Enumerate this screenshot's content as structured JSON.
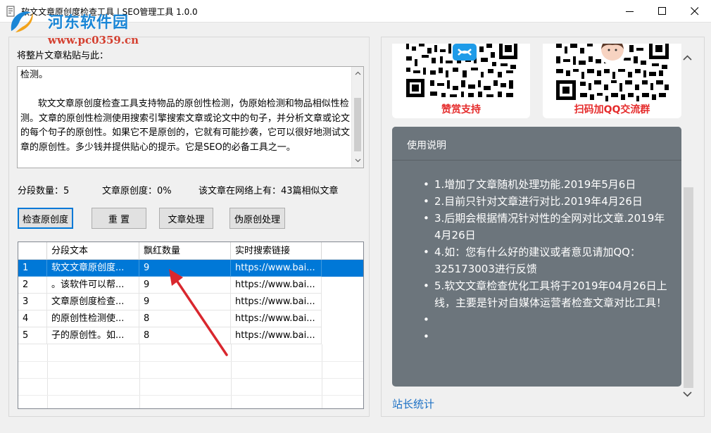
{
  "window": {
    "title": "软文文章原创度检查工具 | SEO管理工具 1.0.0"
  },
  "watermark": {
    "site_name": "河东软件园",
    "url": "www.pc0359.cn"
  },
  "editor": {
    "label": "将整片文章粘贴与此：",
    "text": "检测。\n\n      软文文章原创度检查工具支持物品的原创性检测，伪原始检测和物品相似性检测。文章的原创性检测使用搜索引擎搜索文章或论文中的句子，并分析文章或论文的每个句子的原创性。如果它不是原创的，它就有可能抄袭，它可以很好地测试文章的原创性。多少钱并提供贴心的提示。它是SEO的必备工具之一。"
  },
  "stats": {
    "segments": "分段数量：5",
    "originality": "文章原创度：0%",
    "similar": "该文章在网络上有：43篇相似文章"
  },
  "buttons": {
    "check": "检查原创度",
    "reset": "重 置",
    "process": "文章处理",
    "pseudo": "伪原创处理"
  },
  "table": {
    "headers": [
      "",
      "分段文本",
      "飘红数量",
      "实时搜索链接"
    ],
    "rows": [
      {
        "index": "1",
        "text": "软文文章原创度...",
        "count": "9",
        "link": "https://www.bai..."
      },
      {
        "index": "2",
        "text": "。该软件可以帮...",
        "count": "9",
        "link": "https://www.bai..."
      },
      {
        "index": "3",
        "text": "文章原创度检查...",
        "count": "9",
        "link": "https://www.bai..."
      },
      {
        "index": "4",
        "text": "的原创性检测使...",
        "count": "8",
        "link": "https://www.bai..."
      },
      {
        "index": "5",
        "text": "子的原创性。如...",
        "count": "8",
        "link": "https://www.bai..."
      }
    ],
    "selected_row": 0
  },
  "qr": {
    "left_caption": "赞赏支持",
    "right_caption": "扫码加QQ交流群"
  },
  "info": {
    "title": "使用说明",
    "items": [
      "1.增加了文章随机处理功能.2019年5月6日",
      "2.目前只针对文章进行对比.2019年4月26日",
      "3.后期会根据情况针对性的全网对比文章.2019年4月26日",
      "4.如：您有什么好的建议或者意见请加QQ：325173003进行反馈",
      "5.软文文章检查优化工具将于2019年04月26日上线，主要是针对自媒体运营者检查文章对比工具！",
      "",
      ""
    ]
  },
  "footer": {
    "stat_link": "站长统计"
  },
  "colors": {
    "selection": "#0078d7",
    "info_card": "#6c757c",
    "caption_red": "#e52c2c",
    "link_blue": "#1a6fc4"
  }
}
